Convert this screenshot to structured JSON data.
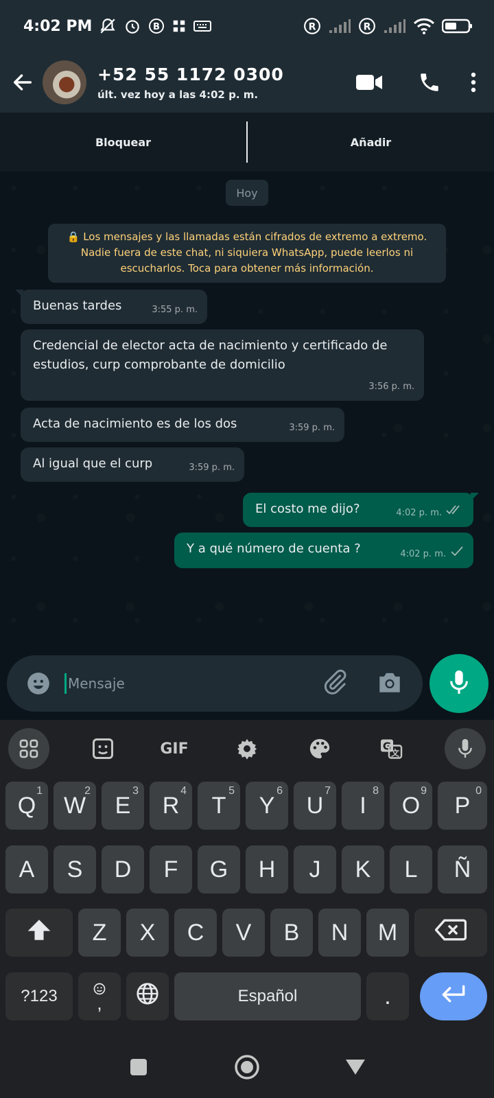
{
  "status_bar": {
    "time": "4:02 PM",
    "icons": [
      "bell-off-icon",
      "alarm-icon",
      "b-badge-icon",
      "grid-icon",
      "keyboard-icon",
      "registered-icon",
      "signal-icon",
      "registered-icon",
      "signal-icon",
      "wifi-icon",
      "battery-icon"
    ]
  },
  "header": {
    "contact": "+52 55 1172 0300",
    "last_seen": "últ. vez hoy a las 4:02 p. m.",
    "icons": [
      "back-arrow-icon",
      "avatar",
      "video-call-icon",
      "phone-icon",
      "more-vert-icon"
    ]
  },
  "actions": {
    "block": "Bloquear",
    "add": "Añadir"
  },
  "day_chip": "Hoy",
  "encryption_notice": "🔒 Los mensajes y las llamadas están cifrados de extremo a extremo. Nadie fuera de este chat, ni siquiera WhatsApp, puede leerlos ni escucharlos. Toca para obtener más información.",
  "messages": [
    {
      "dir": "in",
      "text": "Buenas tardes",
      "time": "3:55 p. m."
    },
    {
      "dir": "in",
      "text": "Credencial de elector acta de nacimiento y certificado de estudios, curp comprobante de domicilio",
      "time": "3:56 p. m."
    },
    {
      "dir": "in",
      "text": "Acta de nacimiento es de los dos",
      "time": "3:59 p. m."
    },
    {
      "dir": "in",
      "text": "Al igual que el curp",
      "time": "3:59 p. m."
    },
    {
      "dir": "out",
      "text": "El costo me dijo?",
      "time": "4:02 p. m.",
      "status": "delivered"
    },
    {
      "dir": "out",
      "text": "Y a qué número de cuenta ?",
      "time": "4:02 p. m.",
      "status": "sent"
    }
  ],
  "composer": {
    "placeholder": "Mensaje",
    "icons": [
      "emoji-icon",
      "attach-icon",
      "camera-icon",
      "mic-icon"
    ]
  },
  "keyboard": {
    "toolbar": [
      "apps-grid-icon",
      "sticker-icon",
      "GIF",
      "settings-icon",
      "palette-icon",
      "translate-icon",
      "mic-icon"
    ],
    "row1": [
      {
        "k": "Q",
        "h": "1"
      },
      {
        "k": "W",
        "h": "2"
      },
      {
        "k": "E",
        "h": "3"
      },
      {
        "k": "R",
        "h": "4"
      },
      {
        "k": "T",
        "h": "5"
      },
      {
        "k": "Y",
        "h": "6"
      },
      {
        "k": "U",
        "h": "7"
      },
      {
        "k": "I",
        "h": "8"
      },
      {
        "k": "O",
        "h": "9"
      },
      {
        "k": "P",
        "h": "0"
      }
    ],
    "row2": [
      "A",
      "S",
      "D",
      "F",
      "G",
      "H",
      "J",
      "K",
      "L",
      "Ñ"
    ],
    "row3": [
      "Z",
      "X",
      "C",
      "V",
      "B",
      "N",
      "M"
    ],
    "symbols_key": "?123",
    "comma_key": ",",
    "space_key": "Español",
    "period_key": ".",
    "icons": [
      "shift-icon",
      "backspace-icon",
      "emoji-small-icon",
      "globe-icon",
      "enter-icon"
    ]
  },
  "nav_bar": {
    "icons": [
      "recents-square-icon",
      "home-circle-icon",
      "back-triangle-icon"
    ]
  },
  "colors": {
    "header_bg": "#1f2c34",
    "chat_bg": "#0b141a",
    "incoming_bubble": "#202c33",
    "outgoing_bubble": "#005c4b",
    "accent": "#00a884",
    "encryption_text": "#ffd279",
    "enter_key": "#669df6"
  }
}
